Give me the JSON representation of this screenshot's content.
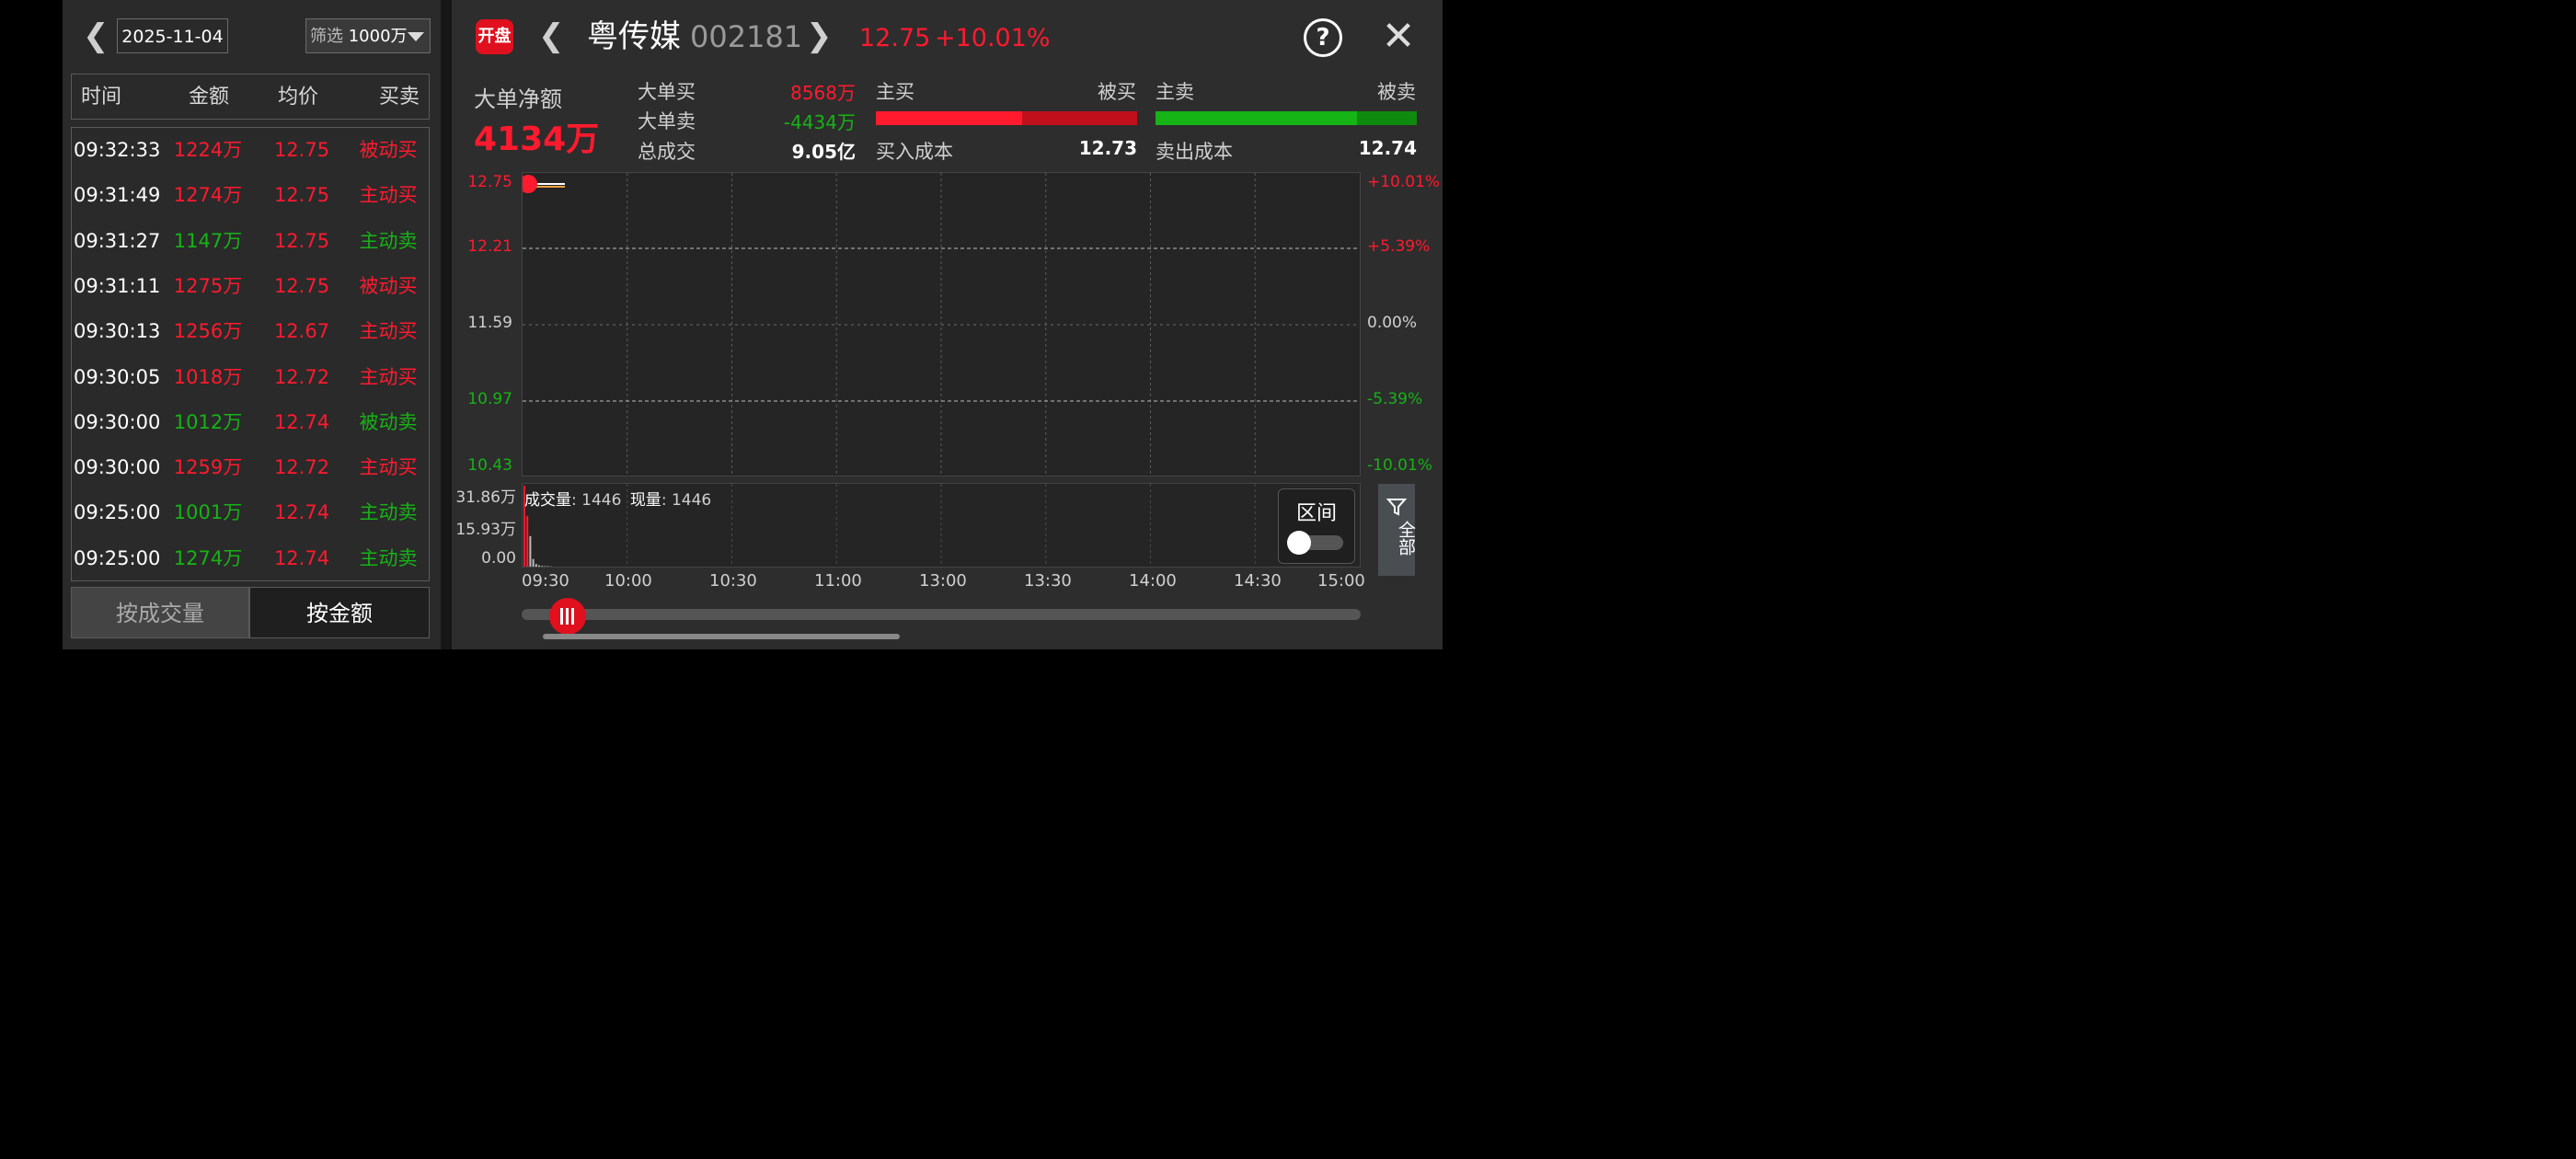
{
  "left": {
    "date": "2025-11-04",
    "filter_label": "筛选",
    "filter_value": "1000万",
    "headers": [
      "时间",
      "金额",
      "均价",
      "买卖"
    ],
    "rows": [
      {
        "time": "09:32:33",
        "amount": "1224万",
        "avg": "12.75",
        "direction": "被动买",
        "side": "buy"
      },
      {
        "time": "09:31:49",
        "amount": "1274万",
        "avg": "12.75",
        "direction": "主动买",
        "side": "buy"
      },
      {
        "time": "09:31:27",
        "amount": "1147万",
        "avg": "12.75",
        "direction": "主动卖",
        "side": "sell"
      },
      {
        "time": "09:31:11",
        "amount": "1275万",
        "avg": "12.75",
        "direction": "被动买",
        "side": "buy"
      },
      {
        "time": "09:30:13",
        "amount": "1256万",
        "avg": "12.67",
        "direction": "主动买",
        "side": "buy"
      },
      {
        "time": "09:30:05",
        "amount": "1018万",
        "avg": "12.72",
        "direction": "主动买",
        "side": "buy"
      },
      {
        "time": "09:30:00",
        "amount": "1012万",
        "avg": "12.74",
        "direction": "被动卖",
        "side": "sell"
      },
      {
        "time": "09:30:00",
        "amount": "1259万",
        "avg": "12.72",
        "direction": "主动买",
        "side": "buy"
      },
      {
        "time": "09:25:00",
        "amount": "1001万",
        "avg": "12.74",
        "direction": "主动卖",
        "side": "sell"
      },
      {
        "time": "09:25:00",
        "amount": "1274万",
        "avg": "12.74",
        "direction": "主动卖",
        "side": "sell"
      }
    ],
    "btn_by_volume": "按成交量",
    "btn_by_amount": "按金额"
  },
  "header": {
    "logo_text": "开盘",
    "stock_name": "粤传媒",
    "stock_code": "002181",
    "price": "12.75",
    "change_pct": "+10.01%"
  },
  "summary": {
    "net_label": "大单净额",
    "net_value": "4134万",
    "big_buy_label": "大单买",
    "big_buy_value": "8568万",
    "big_sell_label": "大单卖",
    "big_sell_value": "-4434万",
    "total_label": "总成交",
    "total_value": "9.05亿",
    "main_buy_label": "主买",
    "passive_buy_label": "被买",
    "main_sell_label": "主卖",
    "passive_sell_label": "被卖",
    "buy_cost_label": "买入成本",
    "buy_cost_value": "12.73",
    "sell_cost_label": "卖出成本",
    "sell_cost_value": "12.74",
    "buy_bar_main_fraction": 0.56,
    "sell_bar_main_fraction": 0.77
  },
  "colors": {
    "up": "#ff1a2e",
    "down": "#16b316",
    "neutral": "#cfcfcf"
  },
  "chart_data": {
    "type": "line",
    "y_left_ticks": [
      "12.75",
      "12.21",
      "11.59",
      "10.97",
      "10.43"
    ],
    "y_right_ticks": [
      "+10.01%",
      "+5.39%",
      "0.00%",
      "-5.39%",
      "-10.01%"
    ],
    "x_ticks": [
      "09:30",
      "10:00",
      "10:30",
      "11:00",
      "13:00",
      "13:30",
      "14:00",
      "14:30",
      "15:00"
    ],
    "ylim": [
      10.43,
      12.75
    ],
    "price_series": [
      {
        "t": "09:25",
        "v": 12.75
      },
      {
        "t": "09:30",
        "v": 12.75
      },
      {
        "t": "09:31",
        "v": 12.75
      },
      {
        "t": "09:32",
        "v": 12.75
      },
      {
        "t": "09:33",
        "v": 12.75
      }
    ],
    "volume_ticks": [
      "31.86万",
      "15.93万",
      "0.00"
    ],
    "volume_label": "成交量",
    "volume_value": "1446",
    "current_label": "现量",
    "current_value": "1446",
    "volume_bars": [
      31.86,
      20.0,
      12.0,
      3.0,
      1.0,
      0.5,
      0.3,
      0.2,
      0.2,
      0.1
    ]
  },
  "controls": {
    "range_label": "区间",
    "all_label": "全部"
  }
}
